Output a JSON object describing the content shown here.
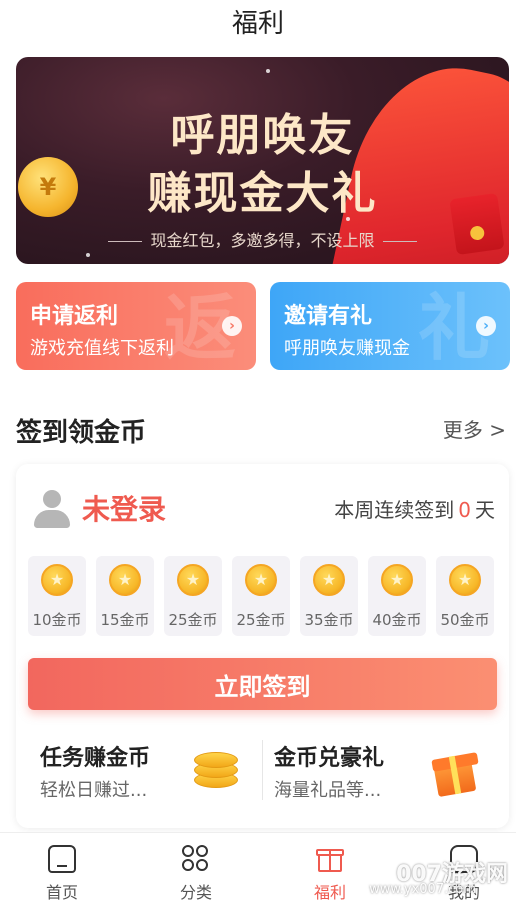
{
  "header": {
    "title": "福利"
  },
  "banner": {
    "line1": "呼朋唤友",
    "line2": "赚现金大礼",
    "subtitle": "现金红包，多邀多得，不设上限",
    "coin_symbol": "¥"
  },
  "promo_cards": {
    "rebate": {
      "title": "申请返利",
      "subtitle": "游戏充值线下返利",
      "watermark": "返",
      "arrow": "›"
    },
    "invite": {
      "title": "邀请有礼",
      "subtitle": "呼朋唤友赚现金",
      "watermark": "礼",
      "arrow": "›"
    }
  },
  "checkin": {
    "section_title": "签到领金币",
    "more_label": "更多 >",
    "login_status": "未登录",
    "streak_prefix": "本周连续签到",
    "streak_days": "0",
    "streak_suffix": "天",
    "days": [
      {
        "amount": "10金币"
      },
      {
        "amount": "15金币"
      },
      {
        "amount": "25金币"
      },
      {
        "amount": "25金币"
      },
      {
        "amount": "35金币"
      },
      {
        "amount": "40金币"
      },
      {
        "amount": "50金币"
      }
    ],
    "button_label": "立即签到"
  },
  "tasks": {
    "earn": {
      "title": "任务赚金币",
      "subtitle": "轻松日赚过..."
    },
    "exchange": {
      "title": "金币兑豪礼",
      "subtitle": "海量礼品等..."
    }
  },
  "tabbar": {
    "items": [
      {
        "label": "首页",
        "icon": "home-icon"
      },
      {
        "label": "分类",
        "icon": "category-icon"
      },
      {
        "label": "福利",
        "icon": "gift-icon",
        "active": true
      },
      {
        "label": "我的",
        "icon": "message-icon"
      }
    ]
  },
  "overlay_watermark": {
    "site": "007游戏网",
    "url": "www.yx007.com"
  },
  "colors": {
    "accent": "#ef5a4f",
    "rebate": "#f96d5c",
    "invite": "#3ea6f7"
  }
}
